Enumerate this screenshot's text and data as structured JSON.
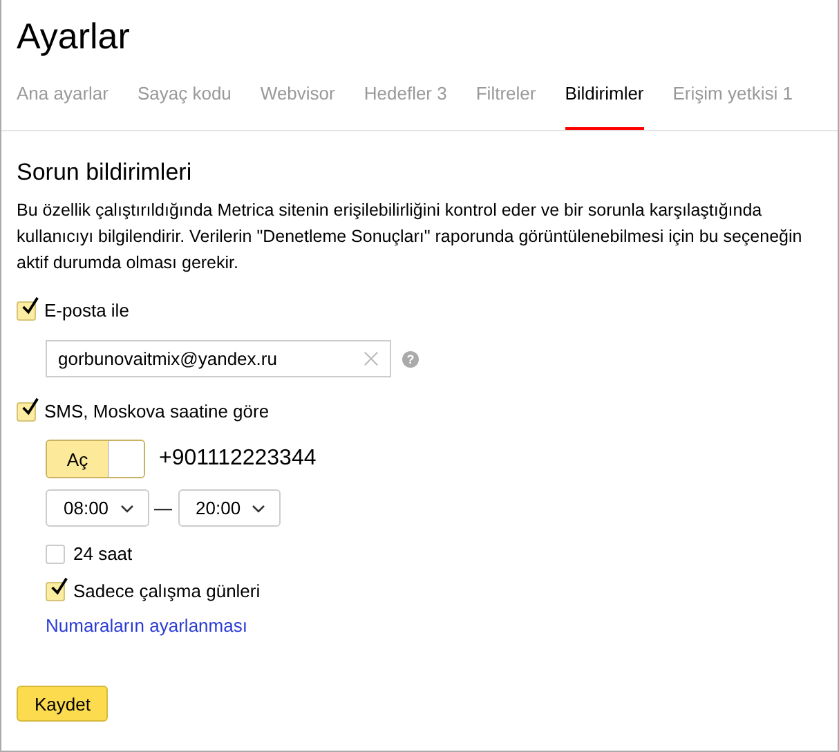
{
  "title": "Ayarlar",
  "tabs": [
    {
      "label": "Ana ayarlar",
      "selected": false
    },
    {
      "label": "Sayaç kodu",
      "selected": false
    },
    {
      "label": "Webvisor",
      "selected": false
    },
    {
      "label": "Hedefler 3",
      "selected": false
    },
    {
      "label": "Filtreler",
      "selected": false
    },
    {
      "label": "Bildirimler",
      "selected": true
    },
    {
      "label": "Erişim yetkisi 1",
      "selected": false
    }
  ],
  "section_title": "Sorun bildirimleri",
  "description": "Bu özellik çalıştırıldığında Metrica sitenin erişilebilirliğini kontrol eder ve bir sorunla karşılaştığında kullanıcıyı bilgilendirir. Verilerin \"Denetleme Sonuçları\" raporunda görüntülenebilmesi için bu seçeneğin aktif durumda olması gerekir.",
  "email": {
    "label": "E-posta ile",
    "checked": true,
    "value": "gorbunovaitmix@yandex.ru",
    "help": "?"
  },
  "sms": {
    "label": "SMS, Moskova saatine göre",
    "checked": true,
    "toggle": {
      "label": "Aç",
      "on": true
    },
    "phone": "+901112223344",
    "time_from": "08:00",
    "separator": "—",
    "time_to": "20:00",
    "options": [
      {
        "label": "24 saat",
        "checked": false
      },
      {
        "label": "Sadece çalışma günleri",
        "checked": true
      }
    ],
    "link": "Numaraların ayarlanması"
  },
  "save_button": "Kaydet"
}
